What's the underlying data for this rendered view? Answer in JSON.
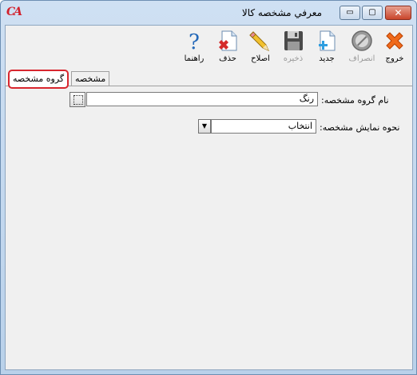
{
  "window": {
    "title": "معرفي مشخصه کالا",
    "app_logo": "CA",
    "controls": {
      "minimize": "▭",
      "maximize": "▢",
      "close": "✕"
    }
  },
  "toolbar": {
    "exit": {
      "label": "خروج",
      "icon": "exit-x-icon"
    },
    "cancel": {
      "label": "انصراف",
      "icon": "cancel-circle-icon",
      "disabled": true
    },
    "new": {
      "label": "جديد",
      "icon": "new-document-icon"
    },
    "save": {
      "label": "ذخيره",
      "icon": "save-floppy-icon",
      "disabled": true
    },
    "edit": {
      "label": "اصلاح",
      "icon": "edit-pencil-icon"
    },
    "delete": {
      "label": "حذف",
      "icon": "delete-document-icon"
    },
    "help": {
      "label": "راهنما",
      "icon": "help-question-icon"
    }
  },
  "tabs": [
    {
      "label": "گروه مشخصه",
      "active": true
    },
    {
      "label": "مشخصه",
      "active": false
    }
  ],
  "form": {
    "group_name_label": "نام گروه مشخصه:",
    "group_name_value": "رنگ",
    "display_mode_label": "نحوه نمايش مشخصه:",
    "display_mode_value": "انتخاب"
  },
  "colors": {
    "accent_red": "#d8262e",
    "title_bg": "#c4d8ee"
  }
}
